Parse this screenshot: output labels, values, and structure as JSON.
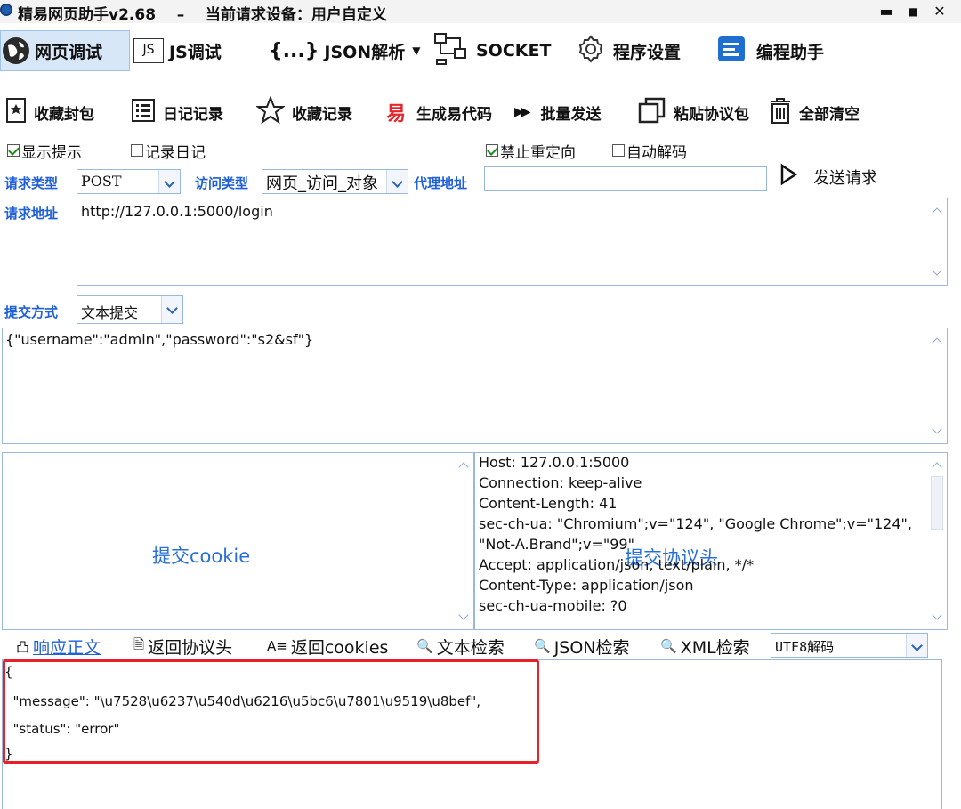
{
  "titlebar": {
    "title": "精易网页助手v2.68    –    当前请求设备：用户自定义",
    "minimize": "▬",
    "maximize": "■",
    "close": "✕"
  },
  "main_tabs": [
    {
      "label": "网页调试",
      "icon": "globe-icon"
    },
    {
      "label": "JS调试",
      "icon": "js-icon",
      "icon_text": "JS"
    },
    {
      "label": "JSON解析",
      "icon": "braces-icon",
      "icon_text": "{...}"
    },
    {
      "label": "SOCKET",
      "icon": "network-icon"
    },
    {
      "label": "程序设置",
      "icon": "gear-icon"
    },
    {
      "label": "编程助手",
      "icon": "assistant-icon"
    }
  ],
  "toolbar": [
    {
      "label": "收藏封包",
      "icon": "bookmark-icon"
    },
    {
      "label": "日记记录",
      "icon": "list-icon"
    },
    {
      "label": "收藏记录",
      "icon": "star-icon"
    },
    {
      "label": "生成易代码",
      "icon": "easy-code-icon",
      "icon_text": "易"
    },
    {
      "label": "批量发送",
      "icon": "fast-forward-icon",
      "icon_text": "▶▶"
    },
    {
      "label": "粘贴协议包",
      "icon": "copy-icon"
    },
    {
      "label": "全部清空",
      "icon": "trash-icon"
    }
  ],
  "options": {
    "show_tips": {
      "label": "显示提示",
      "checked": true
    },
    "record_log": {
      "label": "记录日记",
      "checked": false
    },
    "no_redirect": {
      "label": "禁止重定向",
      "checked": true
    },
    "auto_decode": {
      "label": "自动解码",
      "checked": false
    }
  },
  "request": {
    "type_label": "请求类型",
    "type_value": "POST",
    "access_label": "访问类型",
    "access_value": "网页_访问_对象",
    "proxy_label": "代理地址",
    "proxy_value": "",
    "send_label": "发送请求",
    "url_label": "请求地址",
    "url_value": "http://127.0.0.1:5000/login",
    "submit_label": "提交方式",
    "submit_value": "文本提交",
    "body": "{\"username\":\"admin\",\"password\":\"s2&sf\"}"
  },
  "cookie_panel": {
    "placeholder": "提交cookie"
  },
  "headers_panel": {
    "placeholder": "提交协议头",
    "lines": [
      "Host: 127.0.0.1:5000",
      "Connection: keep-alive",
      "Content-Length: 41",
      "sec-ch-ua: \"Chromium\";v=\"124\", \"Google Chrome\";v=\"124\",",
      "\"Not-A.Brand\";v=\"99\"",
      "Accept: application/json, text/plain, */*",
      "Content-Type: application/json",
      "sec-ch-ua-mobile: ?0"
    ]
  },
  "response_tabs": [
    {
      "label": "响应正文",
      "icon_text": "凸",
      "active": true
    },
    {
      "label": "返回协议头",
      "icon_text": "🗎",
      "active": false
    },
    {
      "label": "返回cookies",
      "icon_text": "A≡",
      "active": false
    },
    {
      "label": "文本检索",
      "icon_text": "🔍",
      "active": false
    },
    {
      "label": "JSON检索",
      "icon_text": "🔍",
      "active": false
    },
    {
      "label": "XML检索",
      "icon_text": "🔍",
      "active": false
    }
  ],
  "decode": {
    "value": "UTF8解码"
  },
  "response_body": [
    "{",
    "  \"message\": \"\\u7528\\u6237\\u540d\\u6216\\u5bc6\\u7801\\u9519\\u8bef\",",
    "  \"status\": \"error\"",
    "}"
  ],
  "colors": {
    "accent": "#1f5fd8",
    "highlight": "#e8202a"
  }
}
